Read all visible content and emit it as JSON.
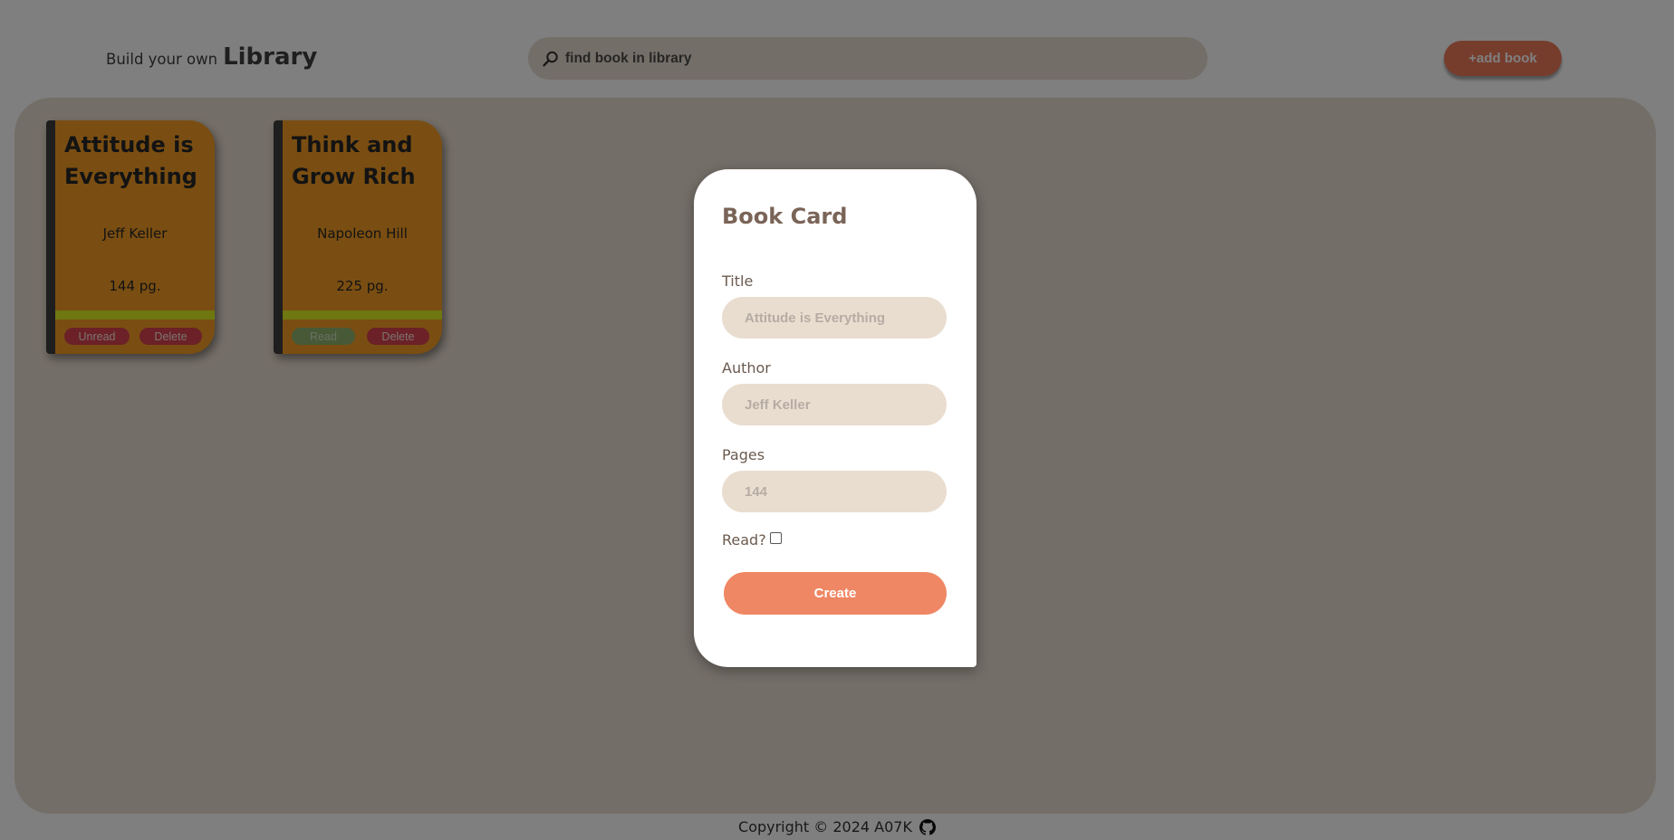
{
  "header": {
    "brand_prefix": "Build your own",
    "brand_name": "Library",
    "search_placeholder": "find book in library",
    "add_button": "+add book"
  },
  "books": [
    {
      "title": "Attitude is Everything",
      "author": "Jeff Keller",
      "pages": "144 pg.",
      "status_button": "Unread",
      "delete_button": "Delete"
    },
    {
      "title": "Think and Grow Rich",
      "author": "Napoleon Hill",
      "pages": "225 pg.",
      "status_button": "Read",
      "delete_button": "Delete"
    }
  ],
  "footer": {
    "copyright": "Copyright © 2024 A07K",
    "icon": "github-icon"
  },
  "modal": {
    "title": "Book Card",
    "title_label": "Title",
    "title_placeholder": "Attitude is Everything",
    "author_label": "Author",
    "author_placeholder": "Jeff Keller",
    "pages_label": "Pages",
    "pages_placeholder": "144",
    "read_label": "Read?",
    "read_checked": false,
    "create_button": "Create"
  },
  "colors": {
    "shelf": "#e9ddd0",
    "book_cover": "#f59d25",
    "book_spine": "#3d3d3d",
    "accent": "#ec7b5b",
    "create_button": "#ef8764",
    "unread_delete": "#d7434f",
    "read": "#8fb36d",
    "stripe": "#ddef20"
  }
}
